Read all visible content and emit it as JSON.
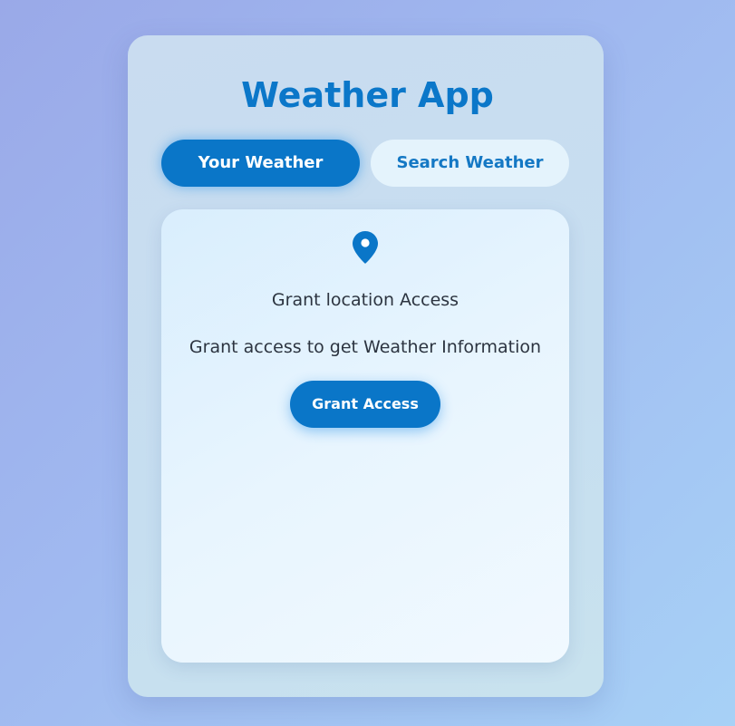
{
  "app": {
    "title": "Weather App"
  },
  "tabs": [
    {
      "label": "Your Weather",
      "active": true
    },
    {
      "label": "Search Weather",
      "active": false
    }
  ],
  "grant_panel": {
    "icon": "location-pin-icon",
    "heading": "Grant location Access",
    "subtext": "Grant access to get Weather Information",
    "button_label": "Grant Access"
  },
  "colors": {
    "accent": "#0a76c8",
    "title": "#0b77c9",
    "inactive_tab_bg": "#e4f3fc",
    "inactive_tab_text": "#1478c4",
    "text": "#2c3440"
  }
}
